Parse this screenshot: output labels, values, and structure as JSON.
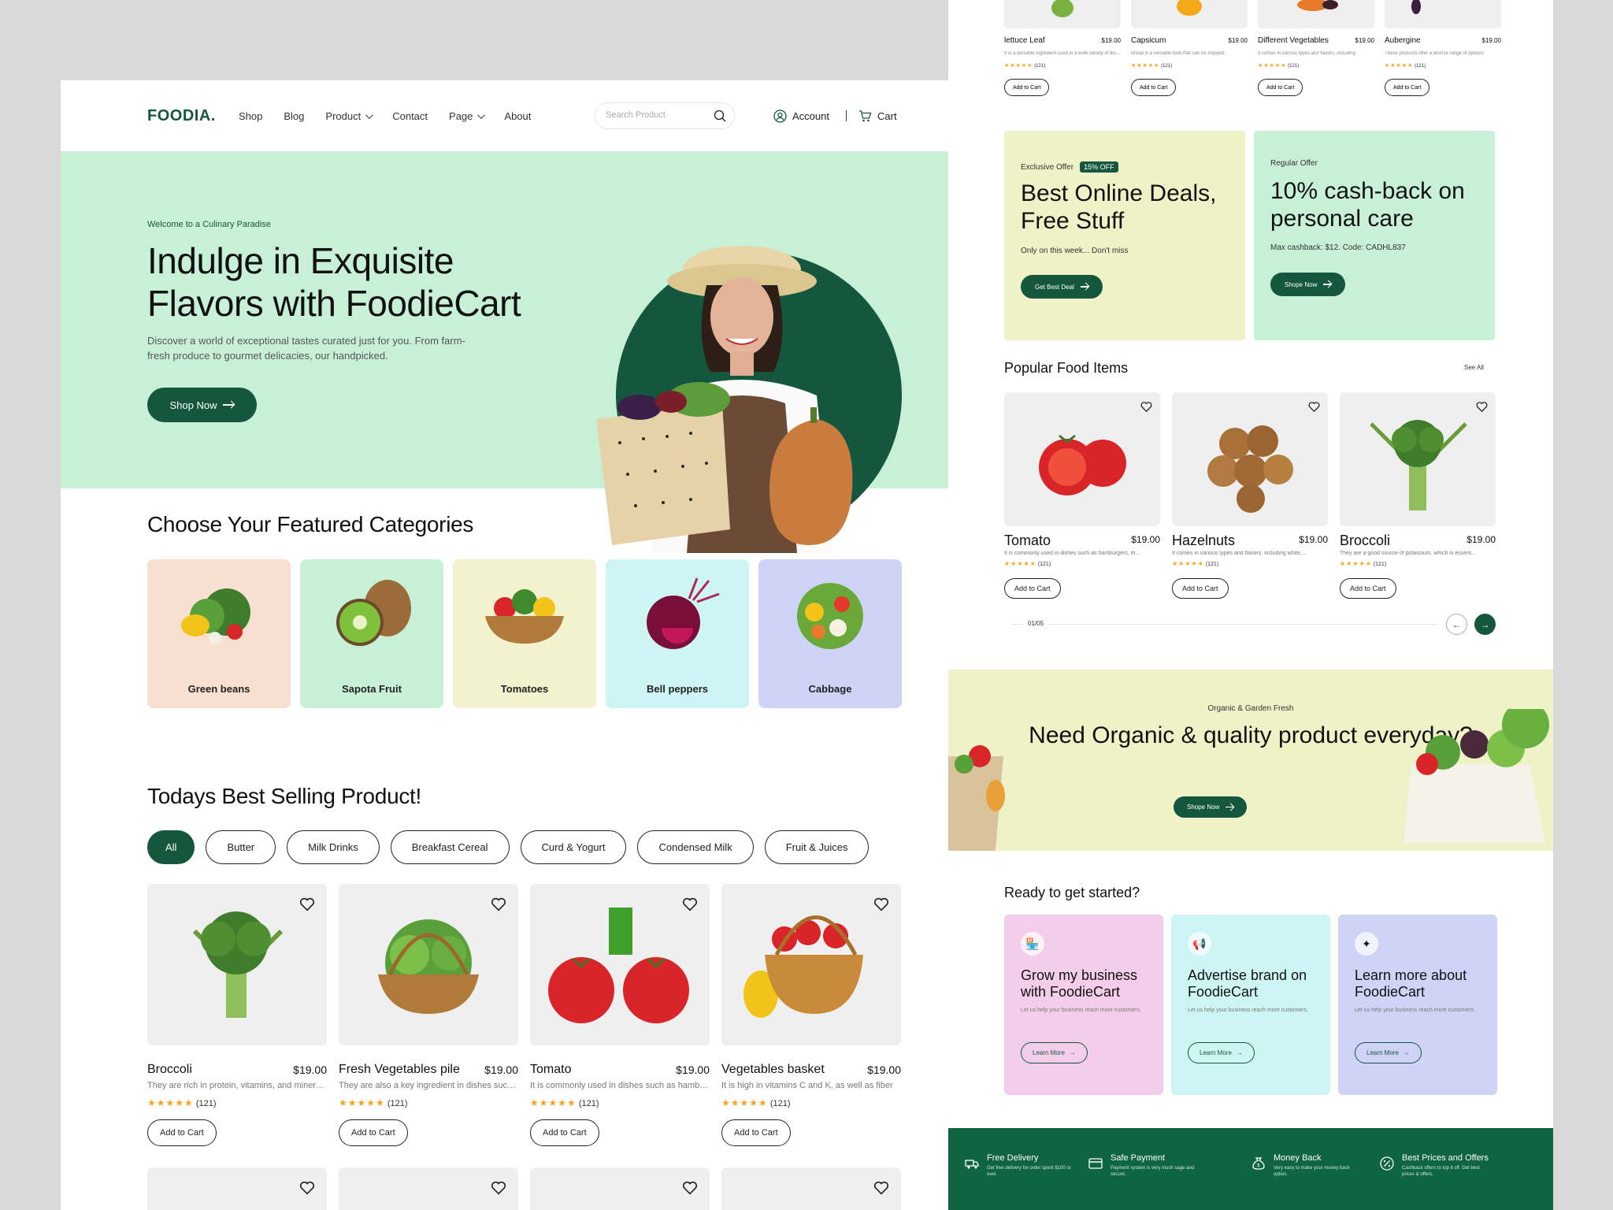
{
  "header": {
    "logo": "FOODIA.",
    "nav": {
      "shop": "Shop",
      "blog": "Blog",
      "product": "Product",
      "contact": "Contact",
      "page": "Page",
      "about": "About"
    },
    "search_placeholder": "Search Product",
    "account": "Account",
    "cart": "Cart"
  },
  "hero": {
    "kicker": "Welcome to a Culinary Paradise",
    "title": "Indulge in Exquisite Flavors with FoodieCart",
    "subtitle": "Discover a world of exceptional tastes curated just for you. From farm-fresh produce to gourmet delicacies, our handpicked.",
    "cta": "Shop Now"
  },
  "categories": {
    "title": "Choose Your Featured Categories",
    "items": [
      {
        "label": "Green beans",
        "color": "#f7e0d0"
      },
      {
        "label": "Sapota Fruit",
        "color": "#c7f0d6"
      },
      {
        "label": "Tomatoes",
        "color": "#f3f2cf"
      },
      {
        "label": "Bell peppers",
        "color": "#cdf5f3"
      },
      {
        "label": "Cabbage",
        "color": "#cfd3f6"
      }
    ]
  },
  "best_selling": {
    "title": "Todays Best Selling Product!",
    "filters": [
      "All",
      "Butter",
      "Milk Drinks",
      "Breakfast Cereal",
      "Curd & Yogurt",
      "Condensed Milk",
      "Fruit & Juices"
    ],
    "products": [
      {
        "name": "Broccoli",
        "price": "$19.00",
        "desc": "They are rich in protein, vitamins, and minerals",
        "rating": "(121)",
        "button": "Add to Cart"
      },
      {
        "name": "Fresh Vegetables pile",
        "price": "$19.00",
        "desc": "They are also a key ingredient in dishes such as",
        "rating": "(121)",
        "button": "Add to Cart"
      },
      {
        "name": "Tomato",
        "price": "$19.00",
        "desc": "It is commonly used in dishes such as hamburgers",
        "rating": "(121)",
        "button": "Add to Cart"
      },
      {
        "name": "Vegetables basket",
        "price": "$19.00",
        "desc": "It is high in vitamins C and K, as well as fiber",
        "rating": "(121)",
        "button": "Add to Cart"
      }
    ]
  },
  "top_products": [
    {
      "name": "lettuce Leaf",
      "price": "$19.00",
      "desc": "It is a versatile ingredient used in a wide variety of dishes",
      "rating": "(121)",
      "button": "Add to Cart"
    },
    {
      "name": "Capsicum",
      "price": "$19.00",
      "desc": "Bread is a versatile food that can be enjoyed",
      "rating": "(121)",
      "button": "Add to Cart"
    },
    {
      "name": "Different Vegetables",
      "price": "$19.00",
      "desc": "It comes in various types and flavors, including",
      "rating": "(121)",
      "button": "Add to Cart"
    },
    {
      "name": "Aubergine",
      "price": "$19.00",
      "desc": "These products offer a diverse range of options",
      "rating": "(121)",
      "button": "Add to Cart"
    }
  ],
  "offers": [
    {
      "kicker": "Exclusive Offer",
      "badge": "15% OFF",
      "title": "Best Online Deals, Free Stuff",
      "sub": "Only on this week... Don't miss",
      "button": "Get Best Deal",
      "color": "#eff2c7"
    },
    {
      "kicker": "Regular Offer",
      "badge": "",
      "title": "10% cash-back on personal care",
      "sub": "Max cashback: $12.  Code: CADHL837",
      "button": "Shope Now",
      "color": "#c7f0d6"
    }
  ],
  "popular": {
    "title": "Popular Food Items",
    "see_all": "See All",
    "items": [
      {
        "name": "Tomato",
        "price": "$19.00",
        "desc": "It is commonly used in dishes such as hamburgers, m...",
        "rating": "(121)",
        "button": "Add to Cart"
      },
      {
        "name": "Hazelnuts",
        "price": "$19.00",
        "desc": "It comes in various types and flavors, including white,...",
        "rating": "(121)",
        "button": "Add to Cart"
      },
      {
        "name": "Broccoli",
        "price": "$19.00",
        "desc": "They are a good source of potassium, which is essent...",
        "rating": "(121)",
        "button": "Add to Cart"
      }
    ],
    "page": "01/05"
  },
  "organic": {
    "kicker": "Organic & Garden Fresh",
    "title": "Need Organic & quality product everyday?",
    "button": "Shope Now"
  },
  "ready": {
    "title": "Ready to get started?",
    "cards": [
      {
        "title": "Grow my business with FoodieCart",
        "desc": "Let us help your business reach more customers.",
        "button": "Learn More",
        "color": "#f3cdea",
        "icon": "shop-icon"
      },
      {
        "title": "Advertise  brand on FoodieCart",
        "desc": "Let us help your business reach more customers.",
        "button": "Learn More",
        "color": "#cdf5f3",
        "icon": "megaphone-icon"
      },
      {
        "title": "Learn more about FoodieCart",
        "desc": "Let us help your business reach more customers.",
        "button": "Learn More",
        "color": "#cfd3f6",
        "icon": "info-icon"
      }
    ]
  },
  "features": [
    {
      "title": "Free Delivery",
      "desc": "Get free delivery for order spent $100 or over.",
      "icon": "truck-icon"
    },
    {
      "title": "Safe Payment",
      "desc": "Payment system is very much sage and secure.",
      "icon": "card-icon"
    },
    {
      "title": "Money Back",
      "desc": "Very easy to make your money back option.",
      "icon": "money-bag-icon"
    },
    {
      "title": "Best Prices and Offers",
      "desc": "Cashback offers to top it off. Get best prices & offers.",
      "icon": "percent-icon"
    }
  ]
}
